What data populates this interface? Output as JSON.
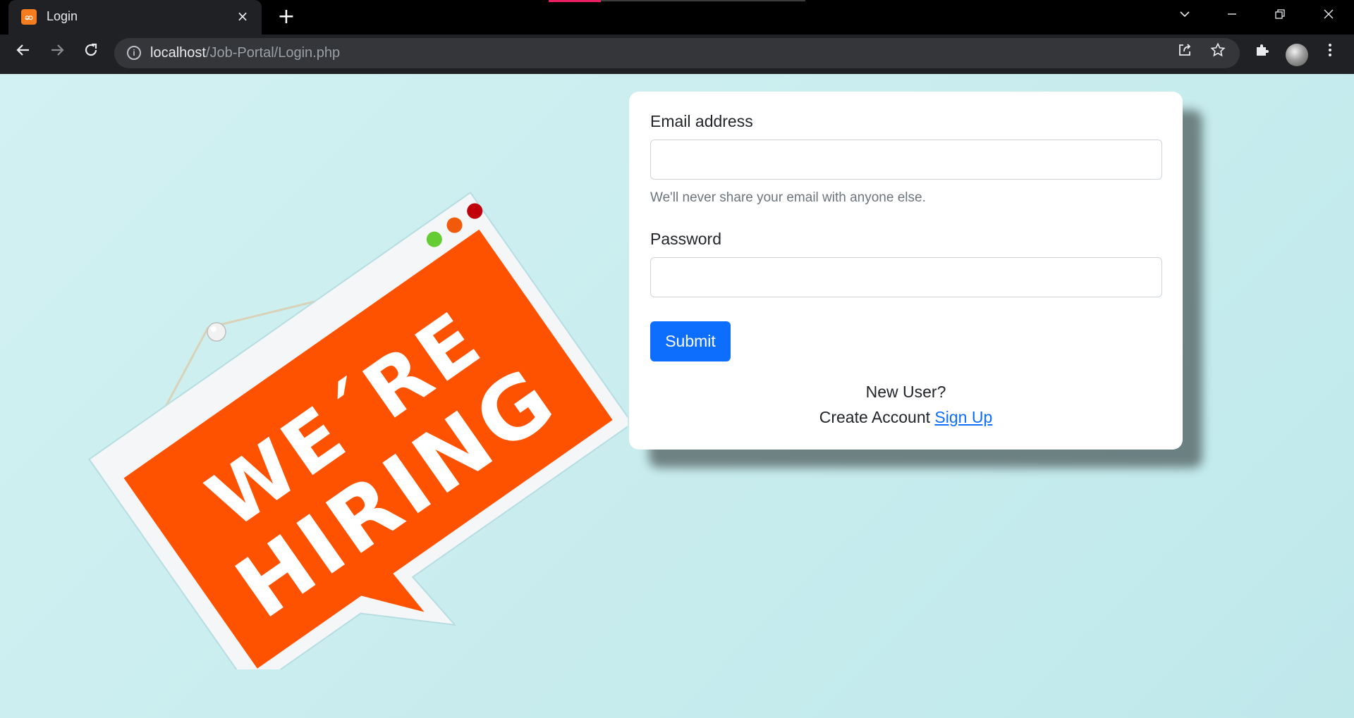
{
  "browser": {
    "tab_title": "Login",
    "tab_close_glyph": "×",
    "new_tab_glyph": "+",
    "favicon_text": "ဆ",
    "url_host": "localhost",
    "url_path": "/Job-Portal/Login.php"
  },
  "hero": {
    "sign_text_line1": "WE´RE",
    "sign_text_line2": "HIRING",
    "colors": {
      "sign": "#ff5200",
      "frame": "#f4f6f8",
      "dot_green": "#66cc33",
      "dot_orange": "#f05a0a",
      "dot_red": "#c0000a"
    }
  },
  "form": {
    "email_label": "Email address",
    "email_value": "",
    "email_help": "We'll never share your email with anyone else.",
    "password_label": "Password",
    "password_value": "",
    "submit_label": "Submit",
    "new_user_text": "New User?",
    "create_account_text": "Create Account",
    "signup_link_text": "Sign Up",
    "colors": {
      "primary": "#0d6efd"
    }
  }
}
